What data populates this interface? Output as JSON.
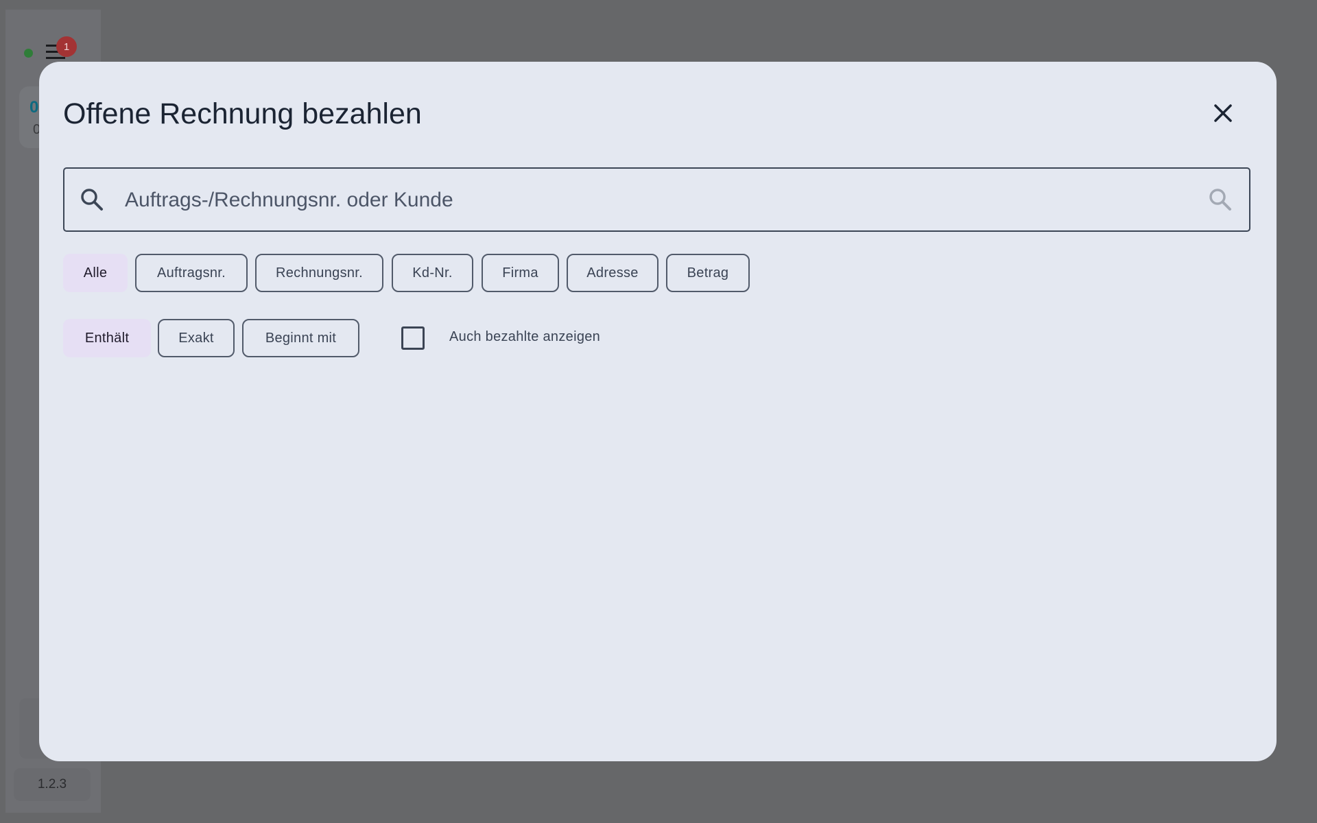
{
  "app": {
    "notification_count": "1",
    "version": "1.2.3",
    "side_card": {
      "line1": "0",
      "line2": "0"
    }
  },
  "dialog": {
    "title": "Offene Rechnung bezahlen",
    "search": {
      "placeholder": "Auftrags-/Rechnungsnr. oder Kunde",
      "value": ""
    },
    "field_chips": [
      "Alle",
      "Auftragsnr.",
      "Rechnungsnr.",
      "Kd-Nr.",
      "Firma",
      "Adresse",
      "Betrag"
    ],
    "selected_field": "Alle",
    "match_chips": [
      "Enthält",
      "Exakt",
      "Beginnt mit"
    ],
    "selected_match": "Enthält",
    "show_paid": {
      "label": "Auch bezahlte anzeigen",
      "checked": false
    }
  },
  "colors": {
    "overlay": "#666769",
    "dialog_bg": "#e4e8f1",
    "selected_chip": "#e6dff4",
    "text": "#1b2433",
    "badge": "#a33334",
    "status_dot": "#2f7d38"
  }
}
